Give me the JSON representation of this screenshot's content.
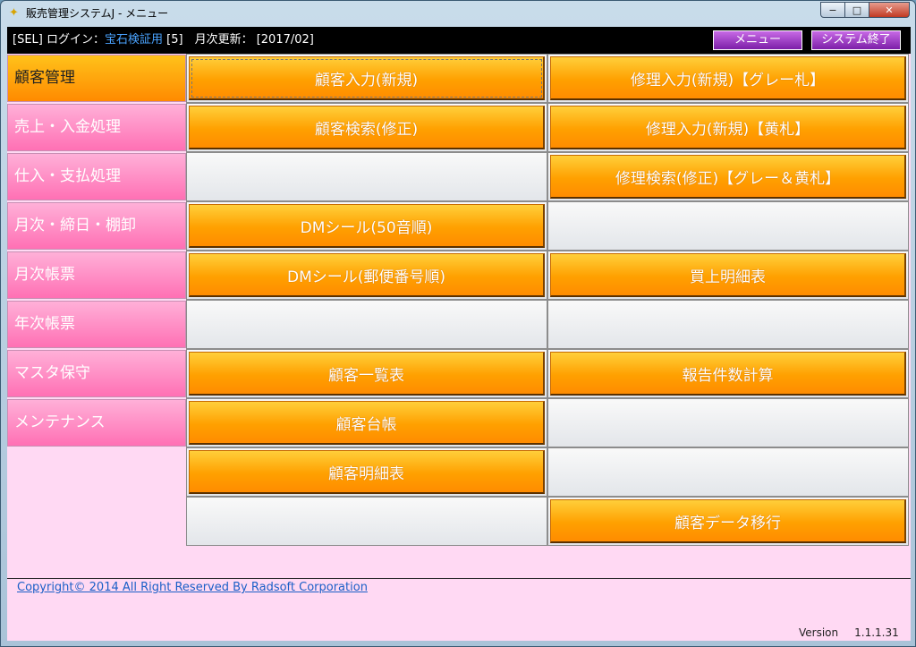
{
  "window": {
    "title": "販売管理システムJ - メニュー",
    "app_icon": "✦"
  },
  "controls": {
    "minimize": "−",
    "maximize": "□",
    "close": "✕"
  },
  "topbar": {
    "prefix": "[SEL] ログイン：",
    "login_name": "宝石検証用",
    "login_id": " [5]",
    "monthly_label": "　月次更新：",
    "monthly_value": " [2017/02]",
    "menu_button": "メニュー",
    "exit_button": "システム終了"
  },
  "nav": [
    "顧客管理",
    "売上・入金処理",
    "仕入・支払処理",
    "月次・締日・棚卸",
    "月次帳票",
    "年次帳票",
    "マスタ保守",
    "メンテナンス"
  ],
  "grid": {
    "left": [
      "顧客入力(新規)",
      "顧客検索(修正)",
      "",
      "DMシール(50音順)",
      "DMシール(郵便番号順)",
      "",
      "顧客一覧表",
      "顧客台帳",
      "顧客明細表",
      ""
    ],
    "right": [
      "修理入力(新規)【グレー札】",
      "修理入力(新規)【黄札】",
      "修理検索(修正)【グレー＆黄札】",
      "",
      "買上明細表",
      "",
      "報告件数計算",
      "",
      "",
      "顧客データ移行"
    ]
  },
  "footer": {
    "copyright": "Copyright© 2014 All Right Reserved By Radsoft Corporation",
    "version_label": "Version",
    "version_value": "1.1.1.31"
  }
}
